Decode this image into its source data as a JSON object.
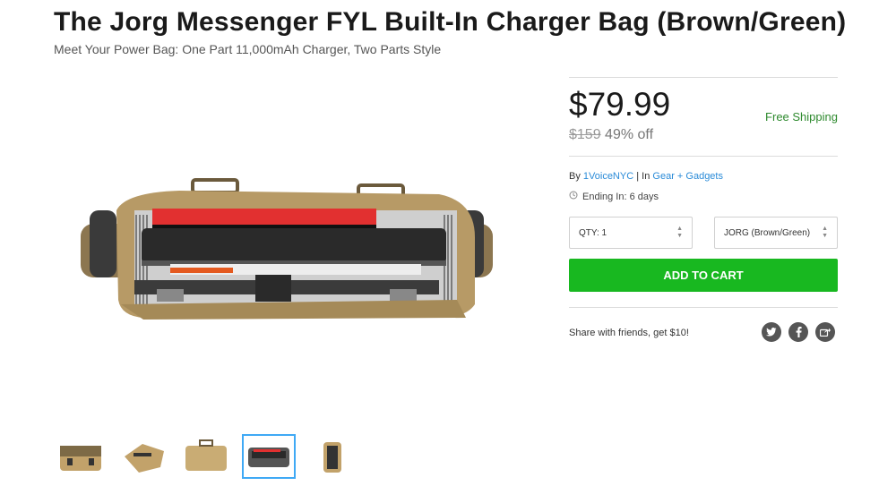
{
  "product": {
    "title": "The Jorg Messenger FYL Built-In Charger Bag (Brown/Green)",
    "subtitle": "Meet Your Power Bag: One Part 11,000mAh Charger, Two Parts Style"
  },
  "pricing": {
    "price": "$79.99",
    "shipping": "Free Shipping",
    "original_price": "$159",
    "discount": "49% off"
  },
  "meta": {
    "by_label": "By",
    "seller": "1VoiceNYC",
    "separator": "|",
    "in_label": "In",
    "category": "Gear + Gadgets",
    "ending": "Ending In: 6 days"
  },
  "options": {
    "qty": "QTY: 1",
    "variant": "JORG (Brown/Green)"
  },
  "cart": {
    "add_label": "ADD TO CART"
  },
  "share": {
    "text": "Share with friends, get $10!",
    "icons": [
      "twitter-icon",
      "facebook-icon",
      "share-icon"
    ]
  },
  "gallery": {
    "active_index": 3,
    "count": 5
  },
  "colors": {
    "accent_green": "#18b820",
    "link_blue": "#2a8bd8",
    "shipping_green": "#2e8a2e"
  }
}
